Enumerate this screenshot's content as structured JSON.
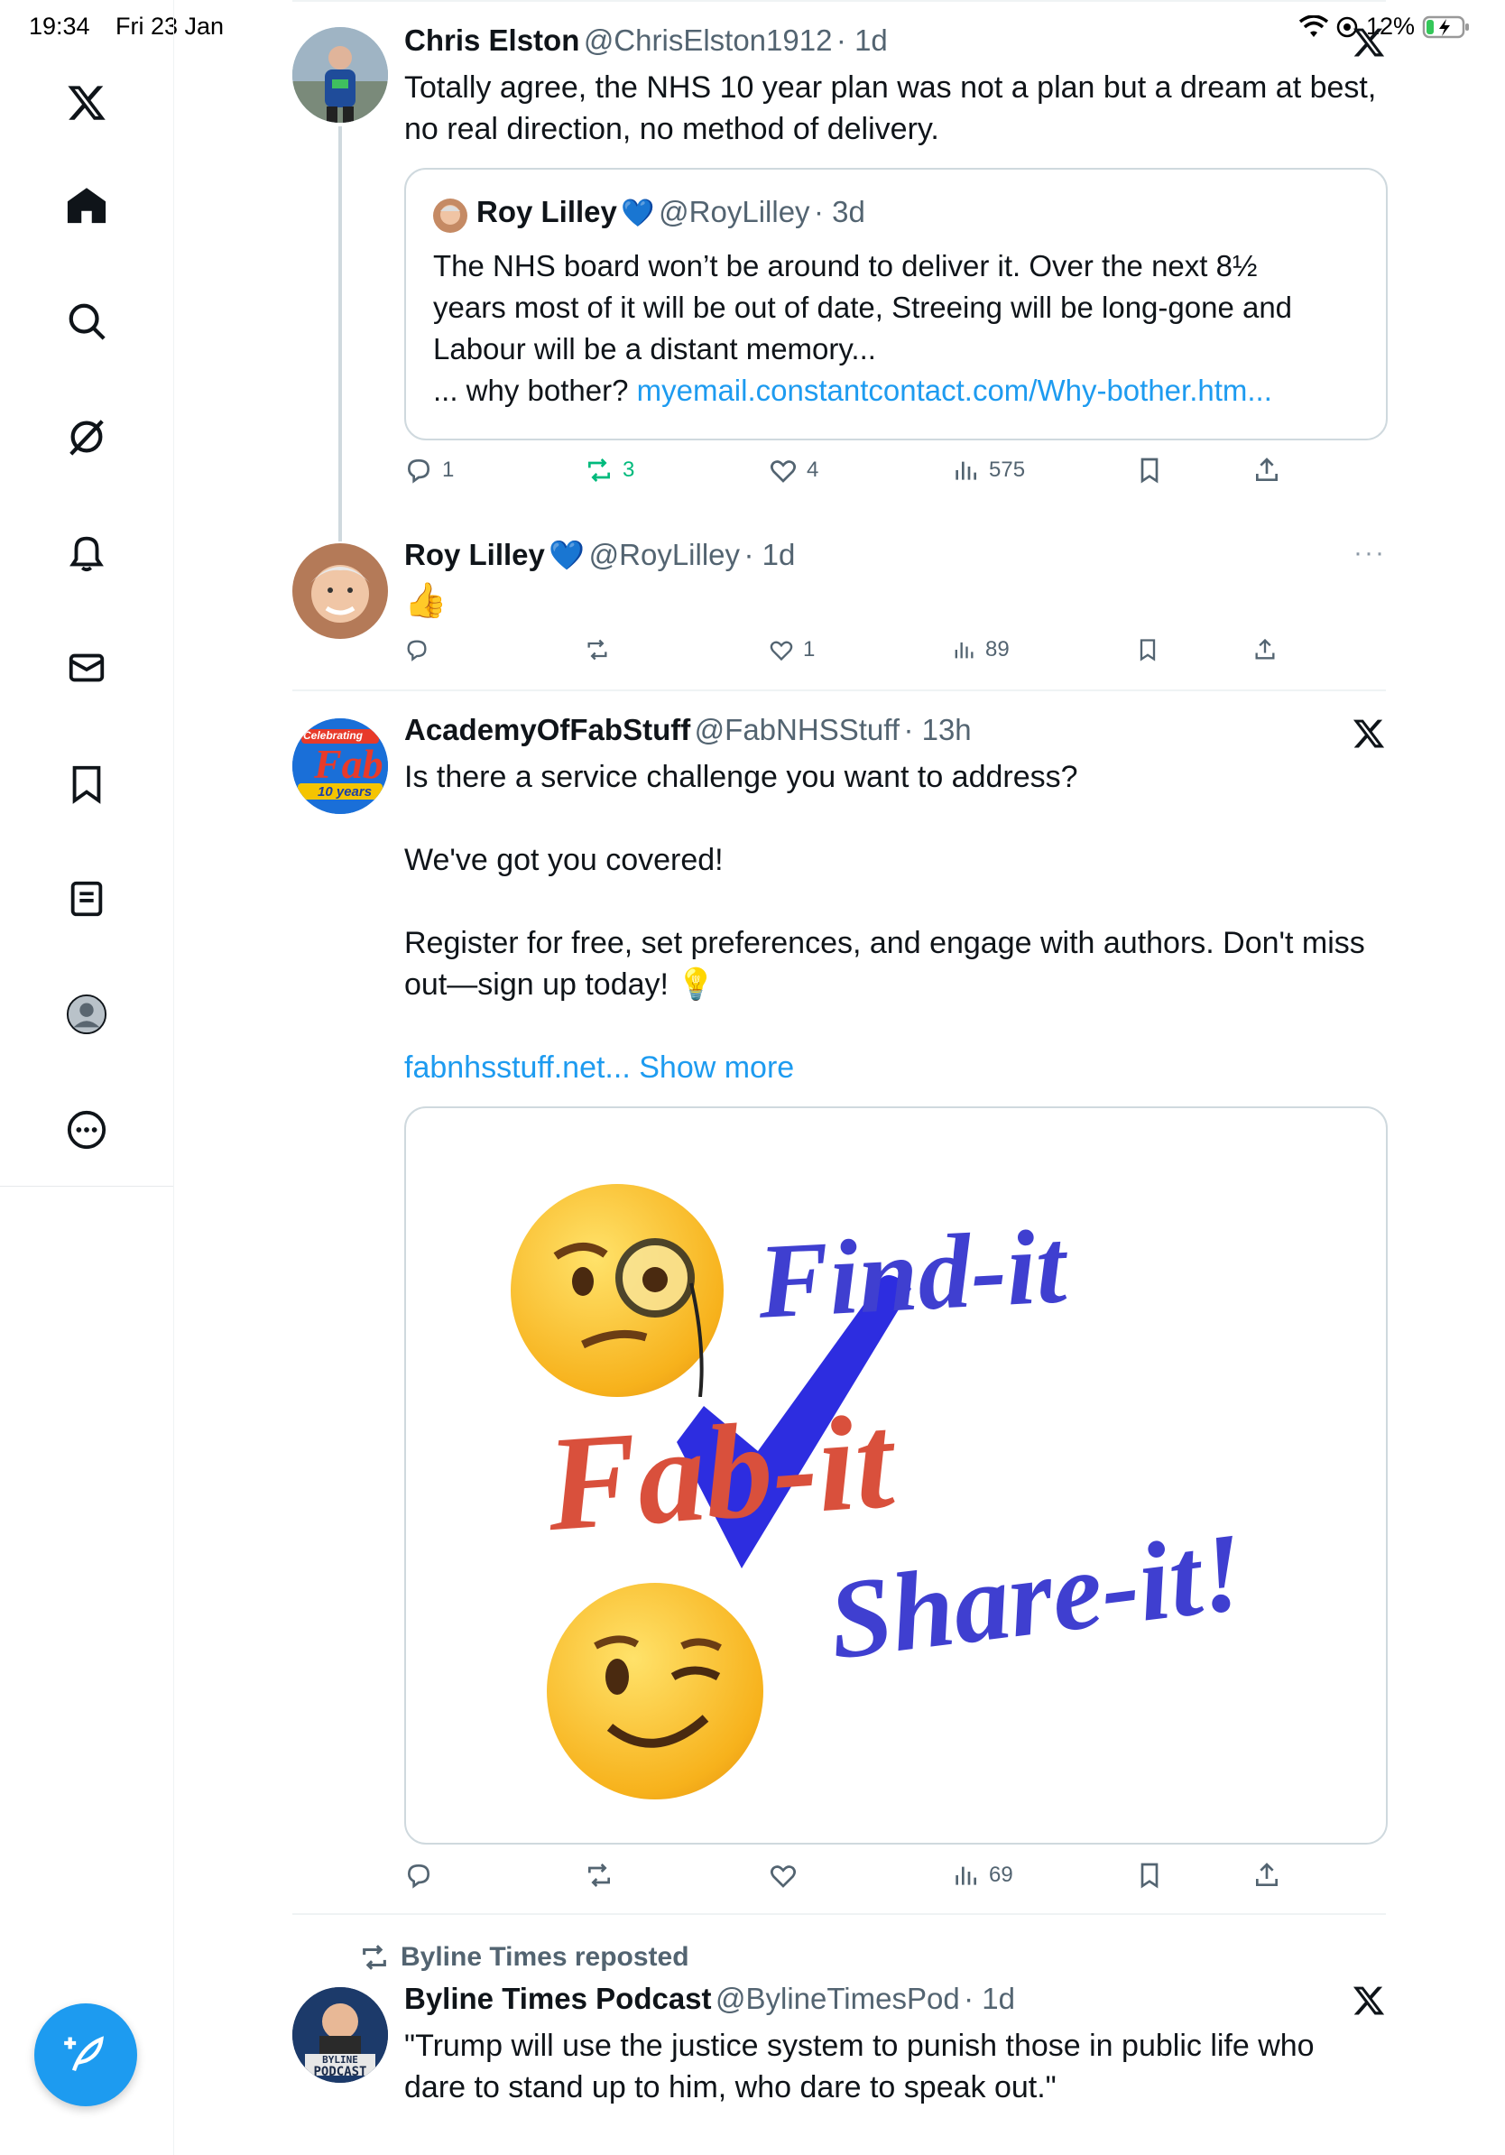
{
  "status_bar": {
    "time": "19:34",
    "date": "Fri 23 Jan",
    "battery": "12%"
  },
  "sidebar": {
    "items": [
      {
        "name": "home"
      },
      {
        "name": "search"
      },
      {
        "name": "grok"
      },
      {
        "name": "notifications"
      },
      {
        "name": "messages"
      },
      {
        "name": "bookmarks"
      },
      {
        "name": "lists"
      },
      {
        "name": "profile"
      },
      {
        "name": "more"
      }
    ]
  },
  "tweets": [
    {
      "name": "Chris Elston",
      "handle": "@ChrisElston1912",
      "time": "· 1d",
      "text_line1": "Totally agree, the NHS 10 year plan was not a plan but a dream at best,",
      "text_line2": "no real direction, no method of delivery.",
      "quote": {
        "name": "Roy Lilley",
        "verified": "💙",
        "handle": "@RoyLilley",
        "time": "· 3d",
        "line1": "The NHS board won’t be around to deliver it. Over the next 8½",
        "line2": "years most of it will be out of date, Streeing will be long-gone and",
        "line3": "Labour will be a distant memory...",
        "line4_prefix": "... why bother?",
        "line4_link": "myemail.constantcontact.com/Why-bother.htm..."
      },
      "replies": "1",
      "reposts": "3",
      "likes": "4",
      "views": "575"
    },
    {
      "name": "Roy Lilley",
      "verified": "💙",
      "handle": "@RoyLilley",
      "time": "· 1d",
      "text": "👍",
      "replies": "",
      "reposts": "",
      "likes": "1",
      "views": "89"
    },
    {
      "name": "AcademyOfFabStuff",
      "handle": "@FabNHSStuff",
      "time": "· 13h",
      "avatar_text_top": "Celebrating",
      "avatar_text_mid": "Fab",
      "avatar_text_bottom": "10 years",
      "p1": "Is there a service challenge you want to address?",
      "p2": "We've got you covered!",
      "p3_line1": "Register for free, set preferences, and engage with authors. Don't miss",
      "p3_line2": "out—sign up today! 💡",
      "link": "fabnhsstuff.net...",
      "show_more": "Show more",
      "media": {
        "line1": "Find-it",
        "line2": "Fab-it",
        "line3": "Share-it!"
      },
      "replies": "",
      "reposts": "",
      "likes": "",
      "views": "69"
    },
    {
      "repost_label": "Byline Times reposted",
      "name": "Byline Times Podcast",
      "handle": "@BylineTimesPod",
      "time": "· 1d",
      "avatar_text_top": "BYLINE",
      "avatar_text_bottom": "PODCAST",
      "line1": "\"Trump will use the justice system to punish those in public life who",
      "line2": "dare to stand up to him, who dare to speak out.\""
    }
  ],
  "colors": {
    "accent": "#1d9bf0",
    "repost_green": "#00ba7c",
    "fab_blue": "#3f3fd0",
    "fab_red": "#d9503c"
  }
}
